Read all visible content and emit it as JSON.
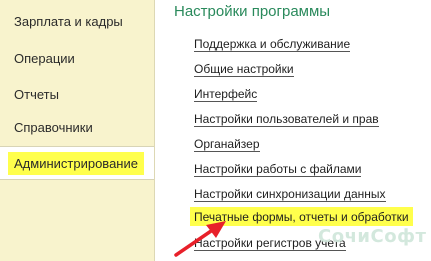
{
  "sidebar": {
    "items": [
      {
        "label": "Зарплата и кадры",
        "active": false
      },
      {
        "label": "Операции",
        "active": false
      },
      {
        "label": "Отчеты",
        "active": false
      },
      {
        "label": "Справочники",
        "active": false
      },
      {
        "label": "Администрирование",
        "active": true
      }
    ]
  },
  "main": {
    "title": "Настройки программы",
    "links": [
      {
        "label": "Поддержка и обслуживание"
      },
      {
        "label": "Общие настройки"
      },
      {
        "label": "Интерфейс"
      },
      {
        "label": "Настройки пользователей и прав"
      },
      {
        "label": "Органайзер"
      },
      {
        "label": "Настройки работы с файлами"
      },
      {
        "label": "Настройки синхронизации данных"
      },
      {
        "label": "Печатные формы, отчеты и обработки",
        "highlighted": true
      },
      {
        "label": "Настройки регистров учета"
      }
    ]
  },
  "watermark": {
    "text": "СочиСофт"
  },
  "colors": {
    "sidebar_bg": "#f8f3cd",
    "highlight": "#ffff4c",
    "title_green": "#2a8a5c",
    "arrow_red": "#e8202a"
  }
}
